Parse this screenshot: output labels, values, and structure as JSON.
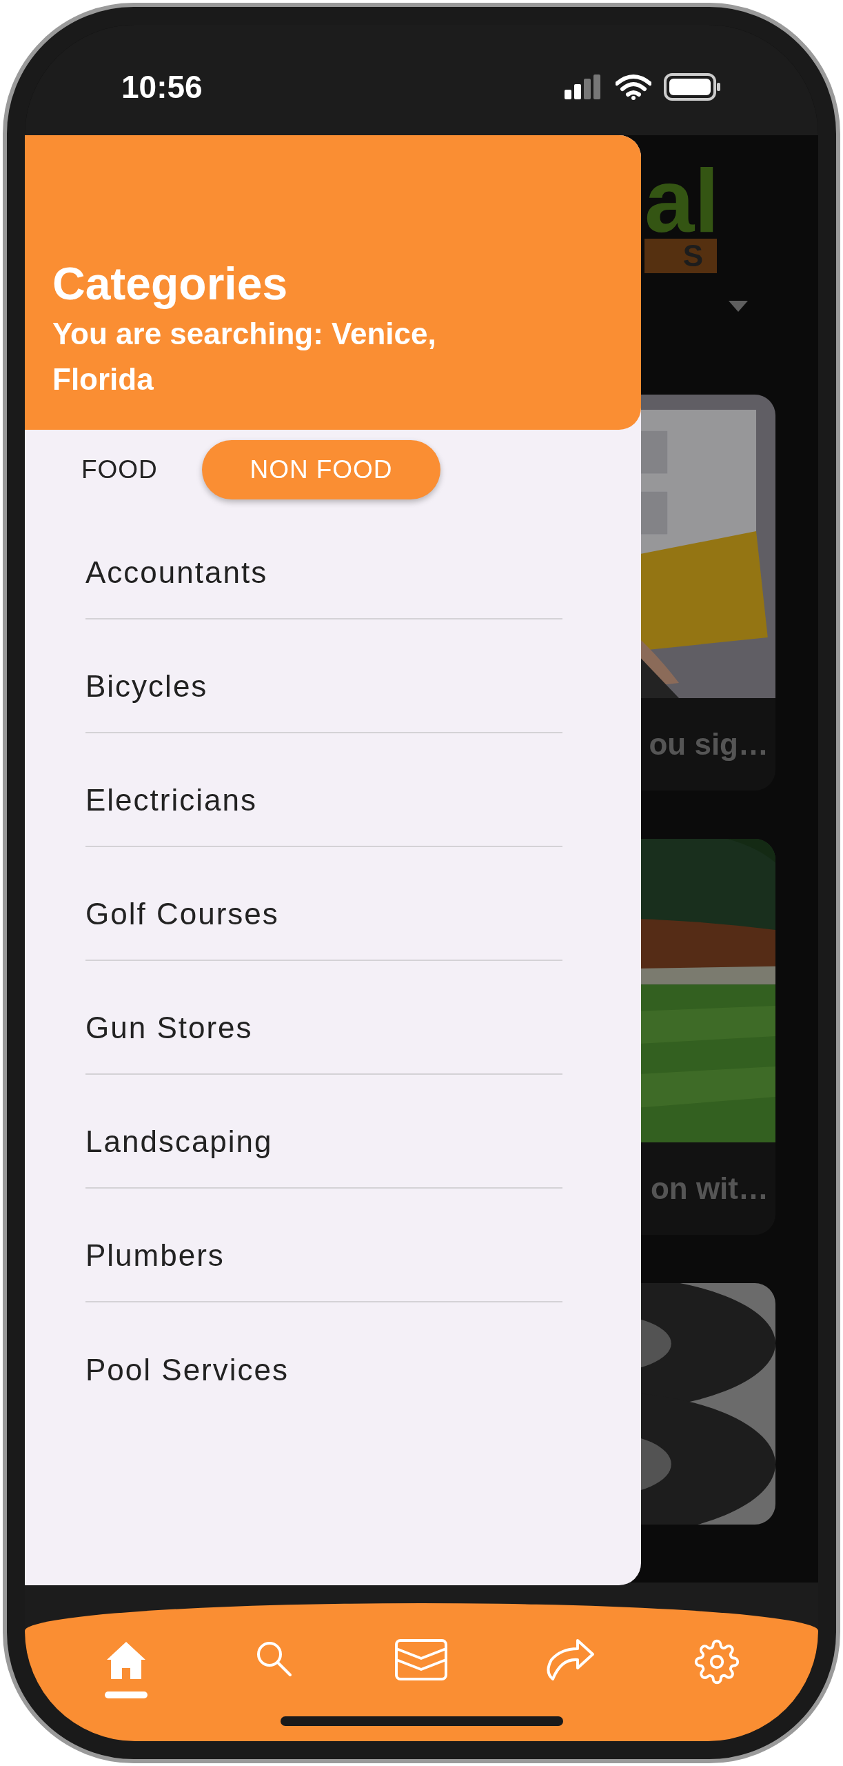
{
  "status_bar": {
    "time": "10:56"
  },
  "background": {
    "logo": {
      "word_part": "al",
      "tag_part": "S"
    },
    "cards": [
      {
        "title": "ou sig…",
        "kind": "picture"
      },
      {
        "title": "on wit…",
        "kind": "picture"
      },
      {
        "kind": "picture"
      }
    ]
  },
  "drawer": {
    "title": "Categories",
    "subtitle": "You are searching: Venice, Florida",
    "tabs": [
      {
        "label": "FOOD",
        "selected": false
      },
      {
        "label": "NON FOOD",
        "selected": true
      }
    ],
    "categories": [
      "Accountants",
      "Bicycles",
      "Electricians",
      "Golf Courses",
      "Gun Stores",
      "Landscaping",
      "Plumbers",
      "Pool Services"
    ]
  },
  "bottom_nav": [
    {
      "kind": "home",
      "selected": true
    },
    {
      "kind": "search",
      "selected": false
    },
    {
      "kind": "mail",
      "selected": false
    },
    {
      "kind": "share",
      "selected": false
    },
    {
      "kind": "settings",
      "selected": false
    }
  ]
}
